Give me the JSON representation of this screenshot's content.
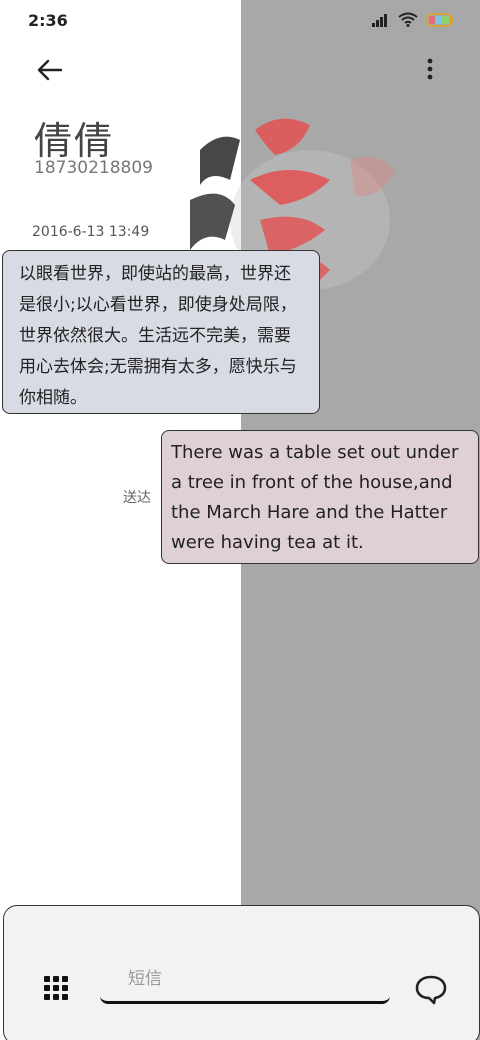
{
  "status_bar": {
    "time": "2:36",
    "icons": [
      "signal-icon",
      "wifi-icon",
      "battery-icon"
    ]
  },
  "header": {
    "back_icon": "arrow-left-icon",
    "more_icon": "more-vertical-icon"
  },
  "contact": {
    "name": "倩倩",
    "number": "18730218809"
  },
  "conversation": {
    "date": "2016-6-13 13:49",
    "incoming_message": "以眼看世界，即使站的最高，世界还是很小;以心看世界，即使身处局限，世界依然很大。生活远不完美，需要用心去体会;无需拥有太多，愿快乐与你相随。",
    "outgoing_message": "There was a table set out under a tree in front of the house,and the March Hare and the Hatter were having tea at it.",
    "outgoing_status": "送达"
  },
  "composer": {
    "placeholder": "短信",
    "apps_icon": "grid-icon",
    "send_icon": "chat-bubble-icon"
  },
  "colors": {
    "right_panel": "#a8a8a8",
    "incoming_bubble": "#d8dbe4",
    "outgoing_bubble": "#dfd1d3",
    "calligraphy_dark": "#333333",
    "calligraphy_red": "#e05555"
  }
}
